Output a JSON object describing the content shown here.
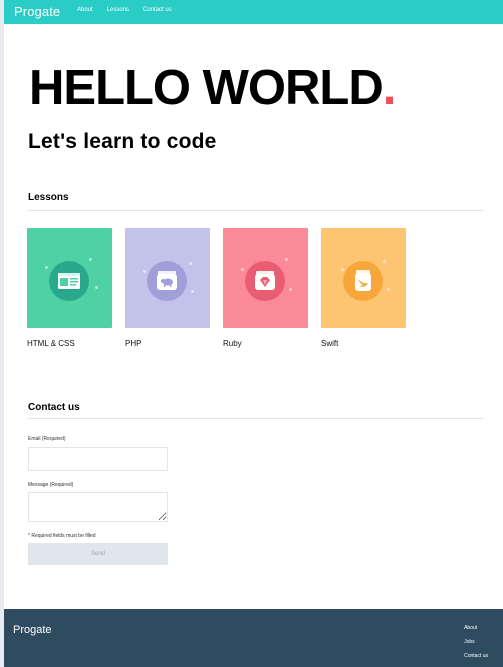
{
  "header": {
    "logo": "Progate",
    "nav": [
      "About",
      "Lessons",
      "Contact us"
    ]
  },
  "hero": {
    "title": "HELLO WORLD",
    "title_dot": ".",
    "subtitle": "Let's learn to code"
  },
  "lessons": {
    "heading": "Lessons",
    "items": [
      {
        "label": "HTML & CSS",
        "bg": "#4fd1a6",
        "circle": "#2aa88b",
        "icon": "browser-window-icon"
      },
      {
        "label": "PHP",
        "bg": "#c3c2ea",
        "circle": "#a19fd9",
        "icon": "elephant-jar-icon"
      },
      {
        "label": "Ruby",
        "bg": "#f98a96",
        "circle": "#e85d72",
        "icon": "gem-jar-icon"
      },
      {
        "label": "Swift",
        "bg": "#fdc572",
        "circle": "#f6a63b",
        "icon": "swift-bird-jar-icon"
      }
    ]
  },
  "contact": {
    "heading": "Contact us",
    "email_label": "Email (Required)",
    "message_label": "Message (Required)",
    "note": "* Required fields must be filled",
    "send_label": "Send"
  },
  "footer": {
    "logo": "Progate",
    "links": [
      "About",
      "Jobs",
      "Contact us"
    ]
  },
  "colors": {
    "header_bg": "#29cdc6",
    "footer_bg": "#2f4b60",
    "accent_dot": "#ee4f5c"
  }
}
